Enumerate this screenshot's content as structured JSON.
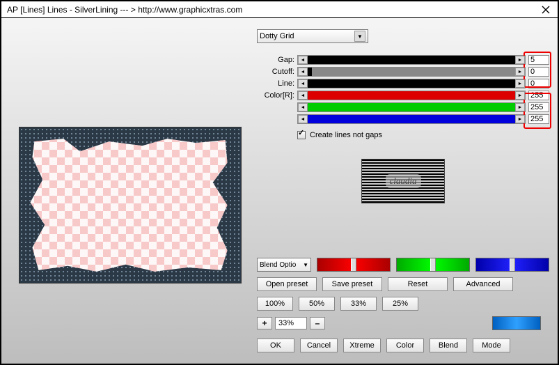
{
  "title": "AP [Lines]  Lines - SilverLining    --- >  http://www.graphicxtras.com",
  "preset": {
    "selected": "Dotty Grid"
  },
  "params": {
    "gap": {
      "label": "Gap:",
      "value": "5"
    },
    "cutoff": {
      "label": "Cutoff:",
      "value": "0"
    },
    "line": {
      "label": "Line:",
      "value": "0"
    },
    "r": {
      "label": "Color[R]:",
      "value": "255"
    },
    "g": {
      "label": "",
      "value": "255"
    },
    "b": {
      "label": "",
      "value": "255"
    }
  },
  "create_lines": {
    "label": "Create lines not gaps",
    "checked": true
  },
  "logo_text": "claudia",
  "blend": {
    "label": "Blend Optio"
  },
  "buttons": {
    "open_preset": "Open preset",
    "save_preset": "Save preset",
    "reset": "Reset",
    "advanced": "Advanced"
  },
  "percent_buttons": [
    "100%",
    "50%",
    "33%",
    "25%"
  ],
  "zoom": {
    "plus": "+",
    "minus": "–",
    "value": "33%"
  },
  "final_buttons": [
    "OK",
    "Cancel",
    "Xtreme",
    "Color",
    "Blend",
    "Mode"
  ]
}
